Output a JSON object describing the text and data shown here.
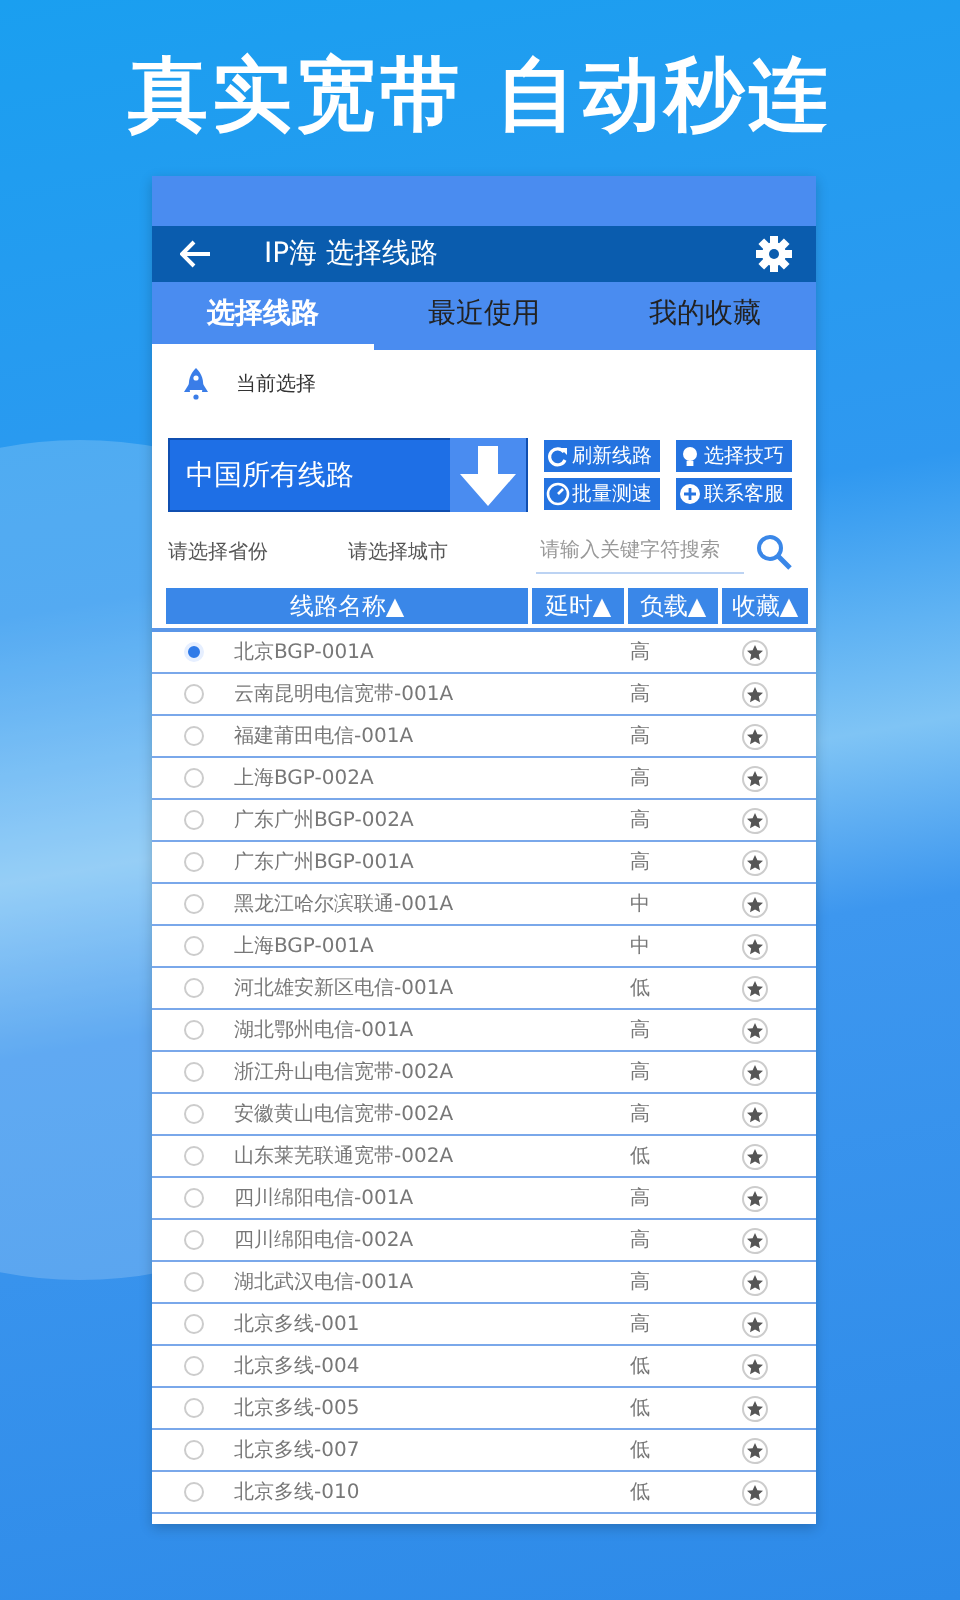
{
  "headline": "真实宽带 自动秒连",
  "app_bar": {
    "title": "IP海 选择线路"
  },
  "tabs": [
    {
      "label": "选择线路",
      "selected": true
    },
    {
      "label": "最近使用",
      "selected": false
    },
    {
      "label": "我的收藏",
      "selected": false
    }
  ],
  "current_label": "当前选择",
  "region_selector": {
    "label": "中国所有线路"
  },
  "actions": [
    {
      "label": "刷新线路",
      "kind": "refresh"
    },
    {
      "label": "选择技巧",
      "kind": "tips"
    },
    {
      "label": "批量测速",
      "kind": "speed"
    },
    {
      "label": "联系客服",
      "kind": "support"
    }
  ],
  "filters": {
    "province": {
      "placeholder": "请选择省份"
    },
    "city": {
      "placeholder": "请选择城市"
    },
    "search": {
      "placeholder": "请输入关键字符搜索"
    }
  },
  "table": {
    "columns": [
      "线路名称▲",
      "延时▲",
      "负载▲",
      "收藏▲"
    ],
    "rows": [
      {
        "name": "北京BGP-001A",
        "load": "高",
        "selected": true
      },
      {
        "name": "云南昆明电信宽带-001A",
        "load": "高",
        "selected": false
      },
      {
        "name": "福建莆田电信-001A",
        "load": "高",
        "selected": false
      },
      {
        "name": "上海BGP-002A",
        "load": "高",
        "selected": false
      },
      {
        "name": "广东广州BGP-002A",
        "load": "高",
        "selected": false
      },
      {
        "name": "广东广州BGP-001A",
        "load": "高",
        "selected": false
      },
      {
        "name": "黑龙江哈尔滨联通-001A",
        "load": "中",
        "selected": false
      },
      {
        "name": "上海BGP-001A",
        "load": "中",
        "selected": false
      },
      {
        "name": "河北雄安新区电信-001A",
        "load": "低",
        "selected": false
      },
      {
        "name": "湖北鄂州电信-001A",
        "load": "高",
        "selected": false
      },
      {
        "name": "浙江舟山电信宽带-002A",
        "load": "高",
        "selected": false
      },
      {
        "name": "安徽黄山电信宽带-002A",
        "load": "高",
        "selected": false
      },
      {
        "name": "山东莱芜联通宽带-002A",
        "load": "低",
        "selected": false
      },
      {
        "name": "四川绵阳电信-001A",
        "load": "高",
        "selected": false
      },
      {
        "name": "四川绵阳电信-002A",
        "load": "高",
        "selected": false
      },
      {
        "name": "湖北武汉电信-001A",
        "load": "高",
        "selected": false
      },
      {
        "name": "北京多线-001",
        "load": "高",
        "selected": false
      },
      {
        "name": "北京多线-004",
        "load": "低",
        "selected": false
      },
      {
        "name": "北京多线-005",
        "load": "低",
        "selected": false
      },
      {
        "name": "北京多线-007",
        "load": "低",
        "selected": false
      },
      {
        "name": "北京多线-010",
        "load": "低",
        "selected": false
      }
    ]
  }
}
